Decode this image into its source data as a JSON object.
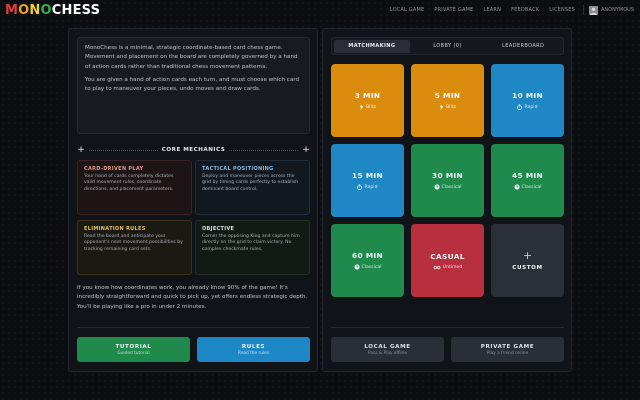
{
  "header": {
    "logo": {
      "m": "M",
      "o1": "O",
      "n": "N",
      "o2": "O",
      "chess": "CHESS"
    },
    "nav": [
      "LOCAL GAME",
      "PRIVATE GAME",
      "LEARN",
      "FEEDBACK",
      "LICENSES"
    ],
    "user": "ANONYMOUS",
    "colors": {
      "m": "#e03b3b",
      "o1": "#f0a21a",
      "n": "#f2d21e",
      "o2": "#2fae5a",
      "chess": "#ffffff"
    }
  },
  "intro": {
    "p1": "MonoChess is a minimal, strategic coordinate-based card chess game. Movement and placement on the board are completely governed by a hand of action cards rather than traditional chess movement patterns.",
    "p2": "You are given a hand of action cards each turn, and must choose which card to play to maneuver your pieces, undo moves and draw cards."
  },
  "core_mechanics": {
    "title": "CORE MECHANICS",
    "items": [
      {
        "title": "CARD-DRIVEN PLAY",
        "desc": "Your hand of cards completely dictates valid movement rules, coordinate directions, and placement parameters."
      },
      {
        "title": "TACTICAL POSITIONING",
        "desc": "Deploy and maneuver pieces across the grid by timing cards perfectly to establish dominant board control."
      },
      {
        "title": "ELIMINATION RULES",
        "desc": "Read the board and anticipate your opponent's next movement possibilities by tracking remaining card sets."
      },
      {
        "title": "OBJECTIVE",
        "desc": "Corner the opposing King and capture him directly on the grid to claim victory. No complex checkmate rules."
      }
    ]
  },
  "outro": "If you know how coordinates work, you already know 90% of the game! It's incredibly straightforward and quick to pick up, yet offers endless strategic depth. You'll be playing like a pro in under 2 minutes.",
  "left_buttons": {
    "tutorial": {
      "label": "TUTORIAL",
      "sub": "Guided tutorial"
    },
    "rules": {
      "label": "RULES",
      "sub": "Read the rules"
    }
  },
  "tabs": [
    "MATCHMAKING",
    "LOBBY (0)",
    "LEADERBOARD"
  ],
  "tiles": [
    {
      "title": "3 MIN",
      "sub": "Blitz",
      "icon": "bolt-icon",
      "color": "#d98c0e"
    },
    {
      "title": "5 MIN",
      "sub": "Blitz",
      "icon": "bolt-icon",
      "color": "#d98c0e"
    },
    {
      "title": "10 MIN",
      "sub": "Rapid",
      "icon": "timer-icon",
      "color": "#1f87c4"
    },
    {
      "title": "15 MIN",
      "sub": "Rapid",
      "icon": "timer-icon",
      "color": "#1f87c4"
    },
    {
      "title": "30 MIN",
      "sub": "Classical",
      "icon": "clock-icon",
      "color": "#1f8a4c"
    },
    {
      "title": "45 MIN",
      "sub": "Classical",
      "icon": "clock-icon",
      "color": "#1f8a4c"
    },
    {
      "title": "60 MIN",
      "sub": "Classical",
      "icon": "clock-icon",
      "color": "#1f8a4c"
    },
    {
      "title": "CASUAL",
      "sub": "Untimed",
      "icon": "infinity-icon",
      "color": "#b8303f"
    },
    {
      "title": "CUSTOM",
      "sub": "",
      "icon": "plus-icon",
      "color": "#2b3038"
    }
  ],
  "right_buttons": {
    "local": {
      "label": "LOCAL GAME",
      "sub": "Pass & Play offline"
    },
    "private": {
      "label": "PRIVATE GAME",
      "sub": "Play a friend online"
    }
  }
}
